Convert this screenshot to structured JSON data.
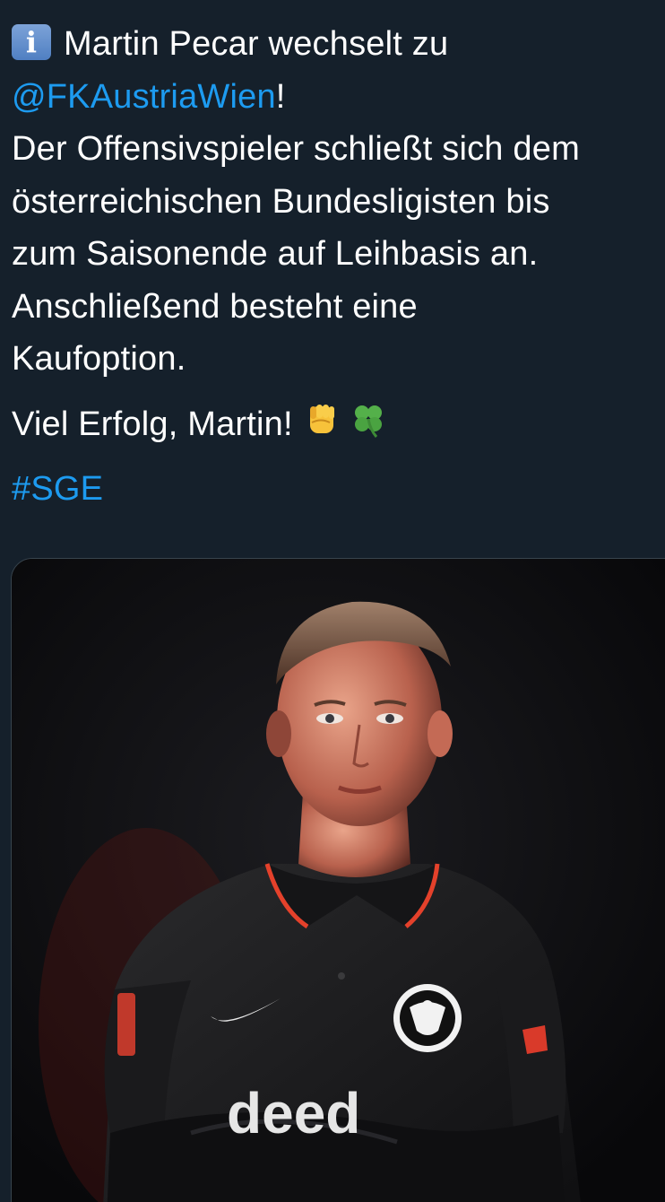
{
  "tweet": {
    "line1_text": "Martin Pecar wechselt zu",
    "mention": "@FKAustriaWien",
    "mention_suffix": "!",
    "body_lines": [
      "Der Offensivspieler schließt sich dem",
      "österreichischen Bundesligisten bis",
      "zum Saisonende auf Leihbasis an.",
      "Anschließend besteht eine",
      "Kaufoption."
    ],
    "closing": "Viel Erfolg, Martin!",
    "hashtag": "#SGE"
  },
  "icons": {
    "info": "information-emoji",
    "fist": "raised-fist-emoji",
    "clover": "four-leaf-clover-emoji"
  },
  "media": {
    "jersey_sponsor": "deed",
    "colors": {
      "background": "#15202b",
      "link": "#1d9bf0",
      "jersey": "#141414",
      "accent": "#e4412b"
    }
  }
}
